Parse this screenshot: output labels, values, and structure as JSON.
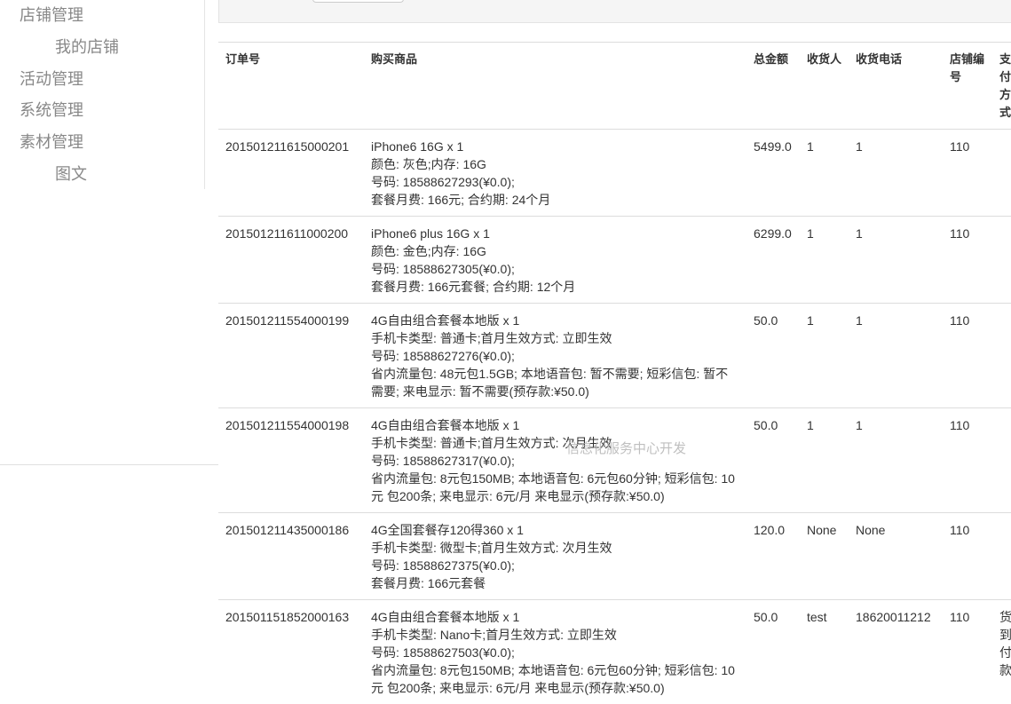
{
  "sidebar": {
    "items": [
      {
        "label": "店铺管理"
      },
      {
        "label": "我的店铺"
      },
      {
        "label": "活动管理"
      },
      {
        "label": "系统管理"
      },
      {
        "label": "素材管理"
      },
      {
        "label": "图文"
      }
    ]
  },
  "table": {
    "headers": [
      "订单号",
      "购买商品",
      "总金额",
      "收货人",
      "收货电话",
      "店铺编号",
      "支付方式"
    ],
    "rows": [
      {
        "order_id": "201501211615000201",
        "product_lines": [
          "iPhone6 16G x 1",
          "颜色: 灰色;内存: 16G",
          "号码: 18588627293(¥0.0);",
          "套餐月费: 166元; 合约期: 24个月"
        ],
        "amount": "5499.0",
        "receiver": "1",
        "phone": "1",
        "store": "110",
        "payment": ""
      },
      {
        "order_id": "201501211611000200",
        "product_lines": [
          "iPhone6 plus 16G x 1",
          "颜色: 金色;内存: 16G",
          "号码: 18588627305(¥0.0);",
          "套餐月费: 166元套餐; 合约期: 12个月"
        ],
        "amount": "6299.0",
        "receiver": "1",
        "phone": "1",
        "store": "110",
        "payment": ""
      },
      {
        "order_id": "201501211554000199",
        "product_lines": [
          "4G自由组合套餐本地版 x 1",
          "手机卡类型: 普通卡;首月生效方式: 立即生效",
          "号码: 18588627276(¥0.0);",
          "省内流量包: 48元包1.5GB; 本地语音包: 暂不需要; 短彩信包: 暂不需要; 来电显示: 暂不需要(预存款:¥50.0)"
        ],
        "amount": "50.0",
        "receiver": "1",
        "phone": "1",
        "store": "110",
        "payment": ""
      },
      {
        "order_id": "201501211554000198",
        "product_lines": [
          "4G自由组合套餐本地版 x 1",
          "手机卡类型: 普通卡;首月生效方式: 次月生效",
          "号码: 18588627317(¥0.0);",
          "省内流量包: 8元包150MB; 本地语音包: 6元包60分钟; 短彩信包: 10元 包200条; 来电显示: 6元/月 来电显示(预存款:¥50.0)"
        ],
        "amount": "50.0",
        "receiver": "1",
        "phone": "1",
        "store": "110",
        "payment": ""
      },
      {
        "order_id": "201501211435000186",
        "product_lines": [
          "4G全国套餐存120得360 x 1",
          "手机卡类型: 微型卡;首月生效方式: 次月生效",
          "号码: 18588627375(¥0.0);",
          "套餐月费: 166元套餐"
        ],
        "amount": "120.0",
        "receiver": "None",
        "phone": "None",
        "store": "110",
        "payment": ""
      },
      {
        "order_id": "201501151852000163",
        "product_lines": [
          "4G自由组合套餐本地版 x 1",
          "手机卡类型: Nano卡;首月生效方式: 立即生效",
          "号码: 18588627503(¥0.0);",
          "省内流量包: 8元包150MB; 本地语音包: 6元包60分钟; 短彩信包: 10元 包200条; 来电显示: 6元/月 来电显示(预存款:¥50.0)"
        ],
        "amount": "50.0",
        "receiver": "test",
        "phone": "18620011212",
        "store": "110",
        "payment": "货到付款"
      }
    ]
  },
  "watermark": "信息化服务中心开发"
}
